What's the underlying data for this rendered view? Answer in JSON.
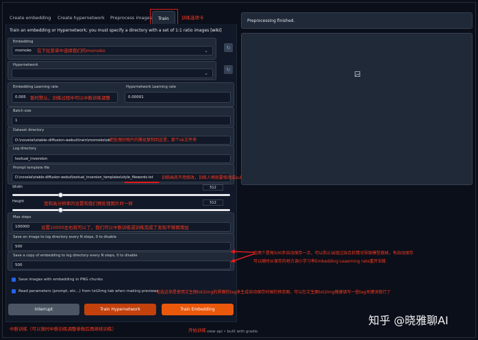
{
  "tabs": [
    "Create embedding",
    "Create hypernetwork",
    "Preprocess images",
    "Train"
  ],
  "description": "Train an embedding or Hypernetwork; you must specify a directory with a set of 1:1 ratio images",
  "description_link": "[wiki]",
  "fields": {
    "embedding_label": "Embedding",
    "embedding_value": "momoko",
    "hypernetwork_label": "Hypernetwork",
    "hypernetwork_value": "",
    "embedding_lr_label": "Embedding Learning rate",
    "embedding_lr_value": "0.005",
    "hypernetwork_lr_label": "Hypernetwork Learning rate",
    "hypernetwork_lr_value": "0.00001",
    "batch_size_label": "Batch size",
    "batch_size_value": "1",
    "dataset_dir_label": "Dataset directory",
    "dataset_dir_value": "D:\\novelai\\stable-diffusion-webui\\train\\momoko\\ok",
    "log_dir_label": "Log directory",
    "log_dir_value": "textual_inversion",
    "prompt_template_label": "Prompt template file",
    "prompt_template_value": "D:\\novelai\\stable-diffusion-webui\\textual_inversion_templates\\style_filewords.txt",
    "width_label": "Width",
    "width_value": "512",
    "width_fraction": 0.22,
    "height_label": "Height",
    "height_value": "512",
    "height_fraction": 0.22,
    "max_steps_label": "Max steps",
    "max_steps_value": "100000",
    "save_image_label": "Save an image to log directory every N steps, 0 to disable",
    "save_image_value": "500",
    "save_embedding_label": "Save a copy of embedding to log directory every N steps, 0 to disable",
    "save_embedding_value": "500",
    "chk_png_label": "Save images with embedding in PNG chunks",
    "chk_params_label": "Read parameters (prompt, etc...) from txt2img tab when making previews"
  },
  "buttons": {
    "interrupt": "Interrupt",
    "train_hypernetwork": "Train Hypernetwork",
    "train_embedding": "Train Embedding"
  },
  "right": {
    "status": "Preprocessing finished."
  },
  "footer": "view api  •  built with gradio",
  "annotations": {
    "train_tab": "训练选项卡",
    "embedding": "在下拉菜单中选择我们的momoko",
    "lr": "暂时默认，训练过程中可以中断训练调整",
    "dataset": "把处理好图片的路径复制到这里，那个ok文件夹",
    "prompt": "训练画风不用修改，训练人物就要修改成subject_filewords.txt",
    "size": "宽和高分辨率的设置和我们预处理图片时一样",
    "steps": "设置10000左右就可以了，我们可以中断训练或训练完成了发现不够再增加",
    "save_n": "这两个是每500步自动保存一次，可以防止出现过拟合的情况导致模型崩掉，有自动保存",
    "save_n2": "可以随时从保存的地方调小学习率Embedding Leaerning rate重开训练",
    "chk": "勾选这项是使用文生图txt2img的界面的tag来生成自动保存时候的预览图，可以在文生图txt2img随便填写一些tag关键词就行了",
    "interrupt": "中断训练（可以随时中断训练调整参数后再继续训练）",
    "train": "开始训练"
  },
  "watermark": "知乎 @晓雅聊AI",
  "colors": {
    "bg": "#0b0f19",
    "panel": "#111827",
    "block": "#1f2937",
    "annotation": "#ff3b1f",
    "train_button": "#f97316"
  }
}
